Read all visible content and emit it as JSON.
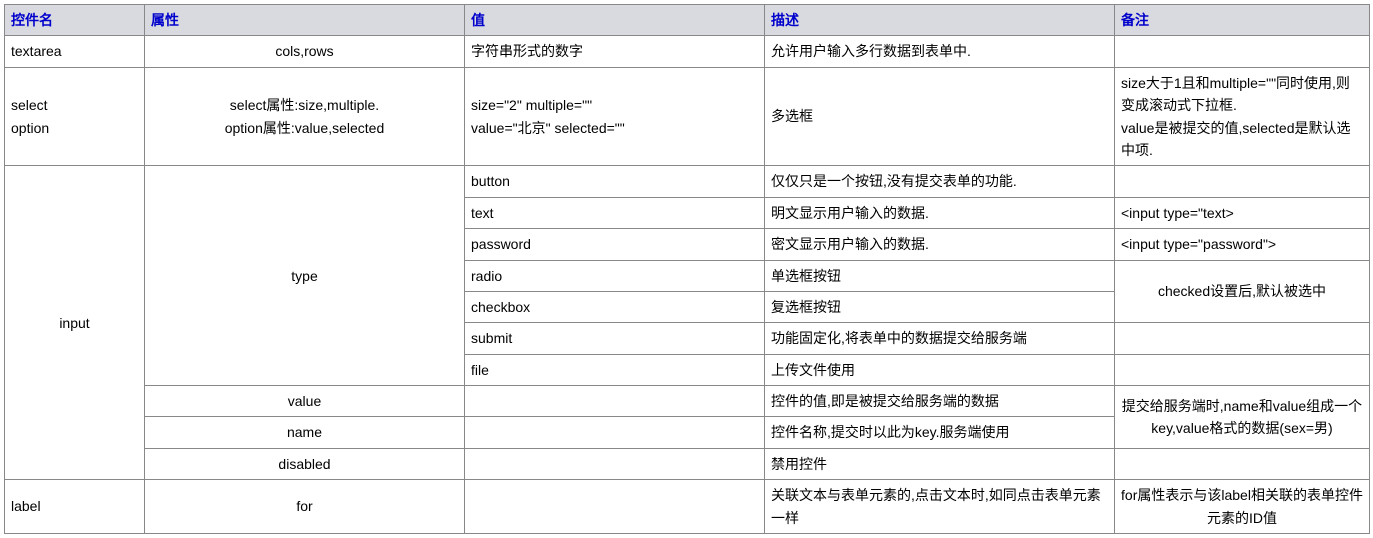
{
  "headers": {
    "name": "控件名",
    "attr": "属性",
    "value": "值",
    "desc": "描述",
    "note": "备注"
  },
  "rows": {
    "textarea": {
      "name": "textarea",
      "attr": "cols,rows",
      "value": "字符串形式的数字",
      "desc": "允许用户输入多行数据到表单中.",
      "note": ""
    },
    "select": {
      "name": "select\noption",
      "attr_line1": "select属性:size,multiple.",
      "attr_line2": "option属性:value,selected",
      "value_line1": "size=\"2\" multiple=\"\"",
      "value_line2": "value=\"北京\" selected=\"\"",
      "desc": "多选框",
      "note": "size大于1且和multiple=\"\"同时使用,则变成滚动式下拉框.\nvalue是被提交的值,selected是默认选中项."
    },
    "input": {
      "name": "input",
      "type": {
        "attr": "type",
        "button": {
          "value": "button",
          "desc": "仅仅只是一个按钮,没有提交表单的功能.",
          "note": ""
        },
        "text": {
          "value": "text",
          "desc": "明文显示用户输入的数据.",
          "note": "<input type=\"text>"
        },
        "password": {
          "value": "password",
          "desc": "密文显示用户输入的数据.",
          "note": "<input type=\"password\">"
        },
        "radio": {
          "value": "radio",
          "desc": "单选框按钮"
        },
        "checkbox": {
          "value": "checkbox",
          "desc": "复选框按钮"
        },
        "radio_checkbox_note": "checked设置后,默认被选中",
        "submit": {
          "value": "submit",
          "desc": "功能固定化,将表单中的数据提交给服务端",
          "note": ""
        },
        "file": {
          "value": "file",
          "desc": "上传文件使用",
          "note": ""
        }
      },
      "value_attr": {
        "attr": "value",
        "value": "",
        "desc": "控件的值,即是被提交给服务端的数据"
      },
      "name_attr": {
        "attr": "name",
        "value": "",
        "desc": "控件名称,提交时以此为key.服务端使用"
      },
      "value_name_note": "提交给服务端时,name和value组成一个key,value格式的数据(sex=男)",
      "disabled": {
        "attr": "disabled",
        "value": "",
        "desc": "禁用控件",
        "note": ""
      }
    },
    "label": {
      "name": "label",
      "attr": "for",
      "value": "",
      "desc": "关联文本与表单元素的,点击文本时,如同点击表单元素一样",
      "note": "for属性表示与该label相关联的表单控件元素的ID值"
    }
  }
}
